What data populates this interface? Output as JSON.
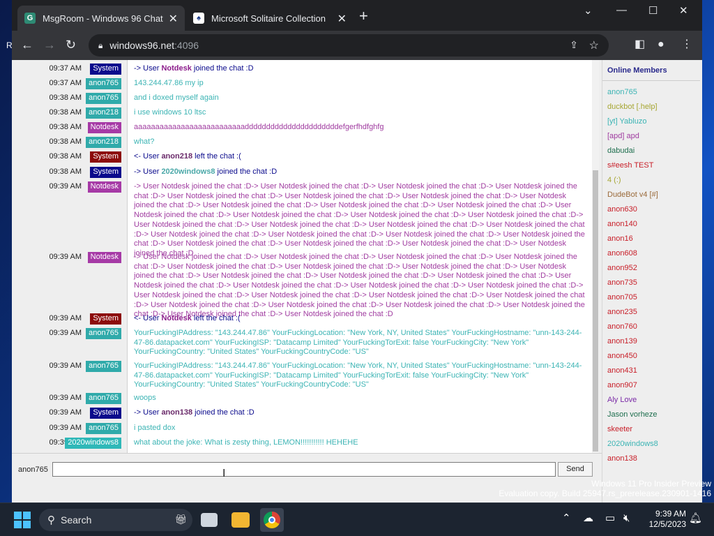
{
  "desktop": {
    "edge_letter": "R"
  },
  "browser": {
    "tabs": [
      {
        "title": "MsgRoom - Windows 96 Chat",
        "active": true
      },
      {
        "title": "Microsoft Solitaire Collection",
        "active": false
      }
    ],
    "new_tab": "+",
    "url": {
      "host": "windows96.net",
      "port": ":4096"
    }
  },
  "chat": {
    "messages": [
      {
        "time": "09:37 AM",
        "user": "System",
        "kind": "system",
        "pre": "-> User ",
        "name": "Notdesk",
        "name_kind": "notdesk",
        "post": " joined the chat :D"
      },
      {
        "time": "09:37 AM",
        "user": "anon765",
        "kind": "anon",
        "text": "143.244.47.86 my ip"
      },
      {
        "time": "09:38 AM",
        "user": "anon765",
        "kind": "anon",
        "text": "and i doxed myself again"
      },
      {
        "time": "09:38 AM",
        "user": "anon218",
        "kind": "anon",
        "text": "i use windows 10 ltsc"
      },
      {
        "time": "09:38 AM",
        "user": "Notdesk",
        "kind": "notdesk",
        "text": "aaaaaaaaaaaaaaaaaaaaaaaaaaddddddddddddddddddddddefgerfhdfghfg"
      },
      {
        "time": "09:38 AM",
        "user": "anon218",
        "kind": "anon",
        "text": "what?"
      },
      {
        "time": "09:38 AM",
        "user": "System",
        "kind": "system-red",
        "pre": "<- User ",
        "name": "anon218",
        "name_kind": "anon",
        "post": " left the chat :("
      },
      {
        "time": "09:38 AM",
        "user": "System",
        "kind": "system",
        "pre": "-> User ",
        "name": "2020windows8",
        "name_kind": "2020",
        "post": " joined the chat :D"
      },
      {
        "time": "09:39 AM",
        "user": "Notdesk",
        "kind": "notdesk",
        "text": "-> User Notdesk joined the chat :D-> User Notdesk joined the chat :D-> User Notdesk joined the chat :D-> User Notdesk joined the chat :D-> User Notdesk joined the chat :D-> User Notdesk joined the chat :D-> User Notdesk joined the chat :D-> User Notdesk joined the chat :D-> User Notdesk joined the chat :D-> User Notdesk joined the chat :D-> User Notdesk joined the chat :D-> User Notdesk joined the chat :D-> User Notdesk joined the chat :D-> User Notdesk joined the chat :D-> User Notdesk joined the chat :D-> User Notdesk joined the chat :D-> User Notdesk joined the chat :D-> User Notdesk joined the chat :D-> User Notdesk joined the chat :D-> User Notdesk joined the chat :D-> User Notdesk joined the chat :D-> User Notdesk joined the chat :D-> User Notdesk joined the chat :D-> User Notdesk joined the chat :D-> User Notdesk joined the chat :D-> User Notdesk joined the chat :D-> User Notdesk joined the chat :D"
      },
      {
        "time": "09:39 AM",
        "user": "Notdesk",
        "kind": "notdesk",
        "text": "-> User Notdesk joined the chat :D-> User Notdesk joined the chat :D-> User Notdesk joined the chat :D-> User Notdesk joined the chat :D-> User Notdesk joined the chat :D-> User Notdesk joined the chat :D-> User Notdesk joined the chat :D-> User Notdesk joined the chat :D-> User Notdesk joined the chat :D-> User Notdesk joined the chat :D-> User Notdesk joined the chat :D-> User Notdesk joined the chat :D-> User Notdesk joined the chat :D-> User Notdesk joined the chat :D-> User Notdesk joined the chat :D-> User Notdesk joined the chat :D-> User Notdesk joined the chat :D-> User Notdesk joined the chat :D-> User Notdesk joined the chat :D-> User Notdesk joined the chat :D-> User Notdesk joined the chat :D-> User Notdesk joined the chat :D-> User Notdesk joined the chat :D-> User Notdesk joined the chat :D-> User Notdesk joined the chat :D"
      },
      {
        "time": "09:39 AM",
        "user": "System",
        "kind": "system-red",
        "pre": "<- User ",
        "name": "Notdesk",
        "name_kind": "notdesk",
        "post": " left the chat :("
      },
      {
        "time": "09:39 AM",
        "user": "anon765",
        "kind": "anon",
        "text": "YourFuckingIPAddress: \"143.244.47.86\" YourFuckingLocation: \"New York, NY, United States\" YourFuckingHostname: \"unn-143-244-47-86.datapacket.com\" YourFuckingISP: \"Datacamp Limited\" YourFuckingTorExit: false YourFuckingCity: \"New York\" YourFuckingCountry: \"United States\" YourFuckingCountryCode: \"US\""
      },
      {
        "time": "09:39 AM",
        "user": "anon765",
        "kind": "anon",
        "text": "YourFuckingIPAddress: \"143.244.47.86\" YourFuckingLocation: \"New York, NY, United States\" YourFuckingHostname: \"unn-143-244-47-86.datapacket.com\" YourFuckingISP: \"Datacamp Limited\" YourFuckingTorExit: false YourFuckingCity: \"New York\" YourFuckingCountry: \"United States\" YourFuckingCountryCode: \"US\""
      },
      {
        "time": "09:39 AM",
        "user": "anon765",
        "kind": "anon",
        "text": "woops"
      },
      {
        "time": "09:39 AM",
        "user": "System",
        "kind": "system",
        "pre": "-> User ",
        "name": "anon138",
        "name_kind": "anon",
        "post": " joined the chat :D"
      },
      {
        "time": "09:39 AM",
        "user": "anon765",
        "kind": "anon",
        "text": "i pasted dox"
      },
      {
        "time": "09:39 AM",
        "user": "2020windows8",
        "kind": "2020",
        "text": "what about the joke: What is zesty thing, LEMON!!!!!!!!!!! HEHEHE"
      }
    ],
    "input": {
      "nick": "anon765",
      "value": "",
      "send_label": "Send"
    }
  },
  "members": {
    "title": "Online Members",
    "list": [
      {
        "name": "anon765",
        "color": "#3cb4b4"
      },
      {
        "name": "duckbot [.help]",
        "color": "#a6a632"
      },
      {
        "name": "[yt] Yabluzo",
        "color": "#3cb4b4"
      },
      {
        "name": "[apd] apd",
        "color": "#a03ca0"
      },
      {
        "name": "dabudai",
        "color": "#1e6e4e"
      },
      {
        "name": "s#eesh TEST",
        "color": "#c81e28"
      },
      {
        "name": "4 (:)",
        "color": "#a6a632"
      },
      {
        "name": "DudeBot v4 [#]",
        "color": "#9a6a3a"
      },
      {
        "name": "anon630",
        "color": "#c81e28"
      },
      {
        "name": "anon140",
        "color": "#c81e28"
      },
      {
        "name": "anon16",
        "color": "#c81e28"
      },
      {
        "name": "anon608",
        "color": "#c81e28"
      },
      {
        "name": "anon952",
        "color": "#c81e28"
      },
      {
        "name": "anon735",
        "color": "#c81e28"
      },
      {
        "name": "anon705",
        "color": "#c81e28"
      },
      {
        "name": "anon235",
        "color": "#c81e28"
      },
      {
        "name": "anon760",
        "color": "#c81e28"
      },
      {
        "name": "anon139",
        "color": "#c81e28"
      },
      {
        "name": "anon450",
        "color": "#c81e28"
      },
      {
        "name": "anon431",
        "color": "#c81e28"
      },
      {
        "name": "anon907",
        "color": "#c81e28"
      },
      {
        "name": "Aly Love",
        "color": "#7a2aa6"
      },
      {
        "name": "Jason vorheze",
        "color": "#1e6e4e"
      },
      {
        "name": "skeeter",
        "color": "#c81e28"
      },
      {
        "name": "2020windows8",
        "color": "#3cb4b4"
      },
      {
        "name": "anon138",
        "color": "#c81e28"
      }
    ]
  },
  "watermark": {
    "line1": "Windows 11 Pro Insider Preview",
    "line2": "Evaluation copy. Build 25947.rs_prerelease.230901-1416"
  },
  "taskbar": {
    "search_placeholder": "Search",
    "time": "9:39 AM",
    "date": "12/5/2023"
  }
}
